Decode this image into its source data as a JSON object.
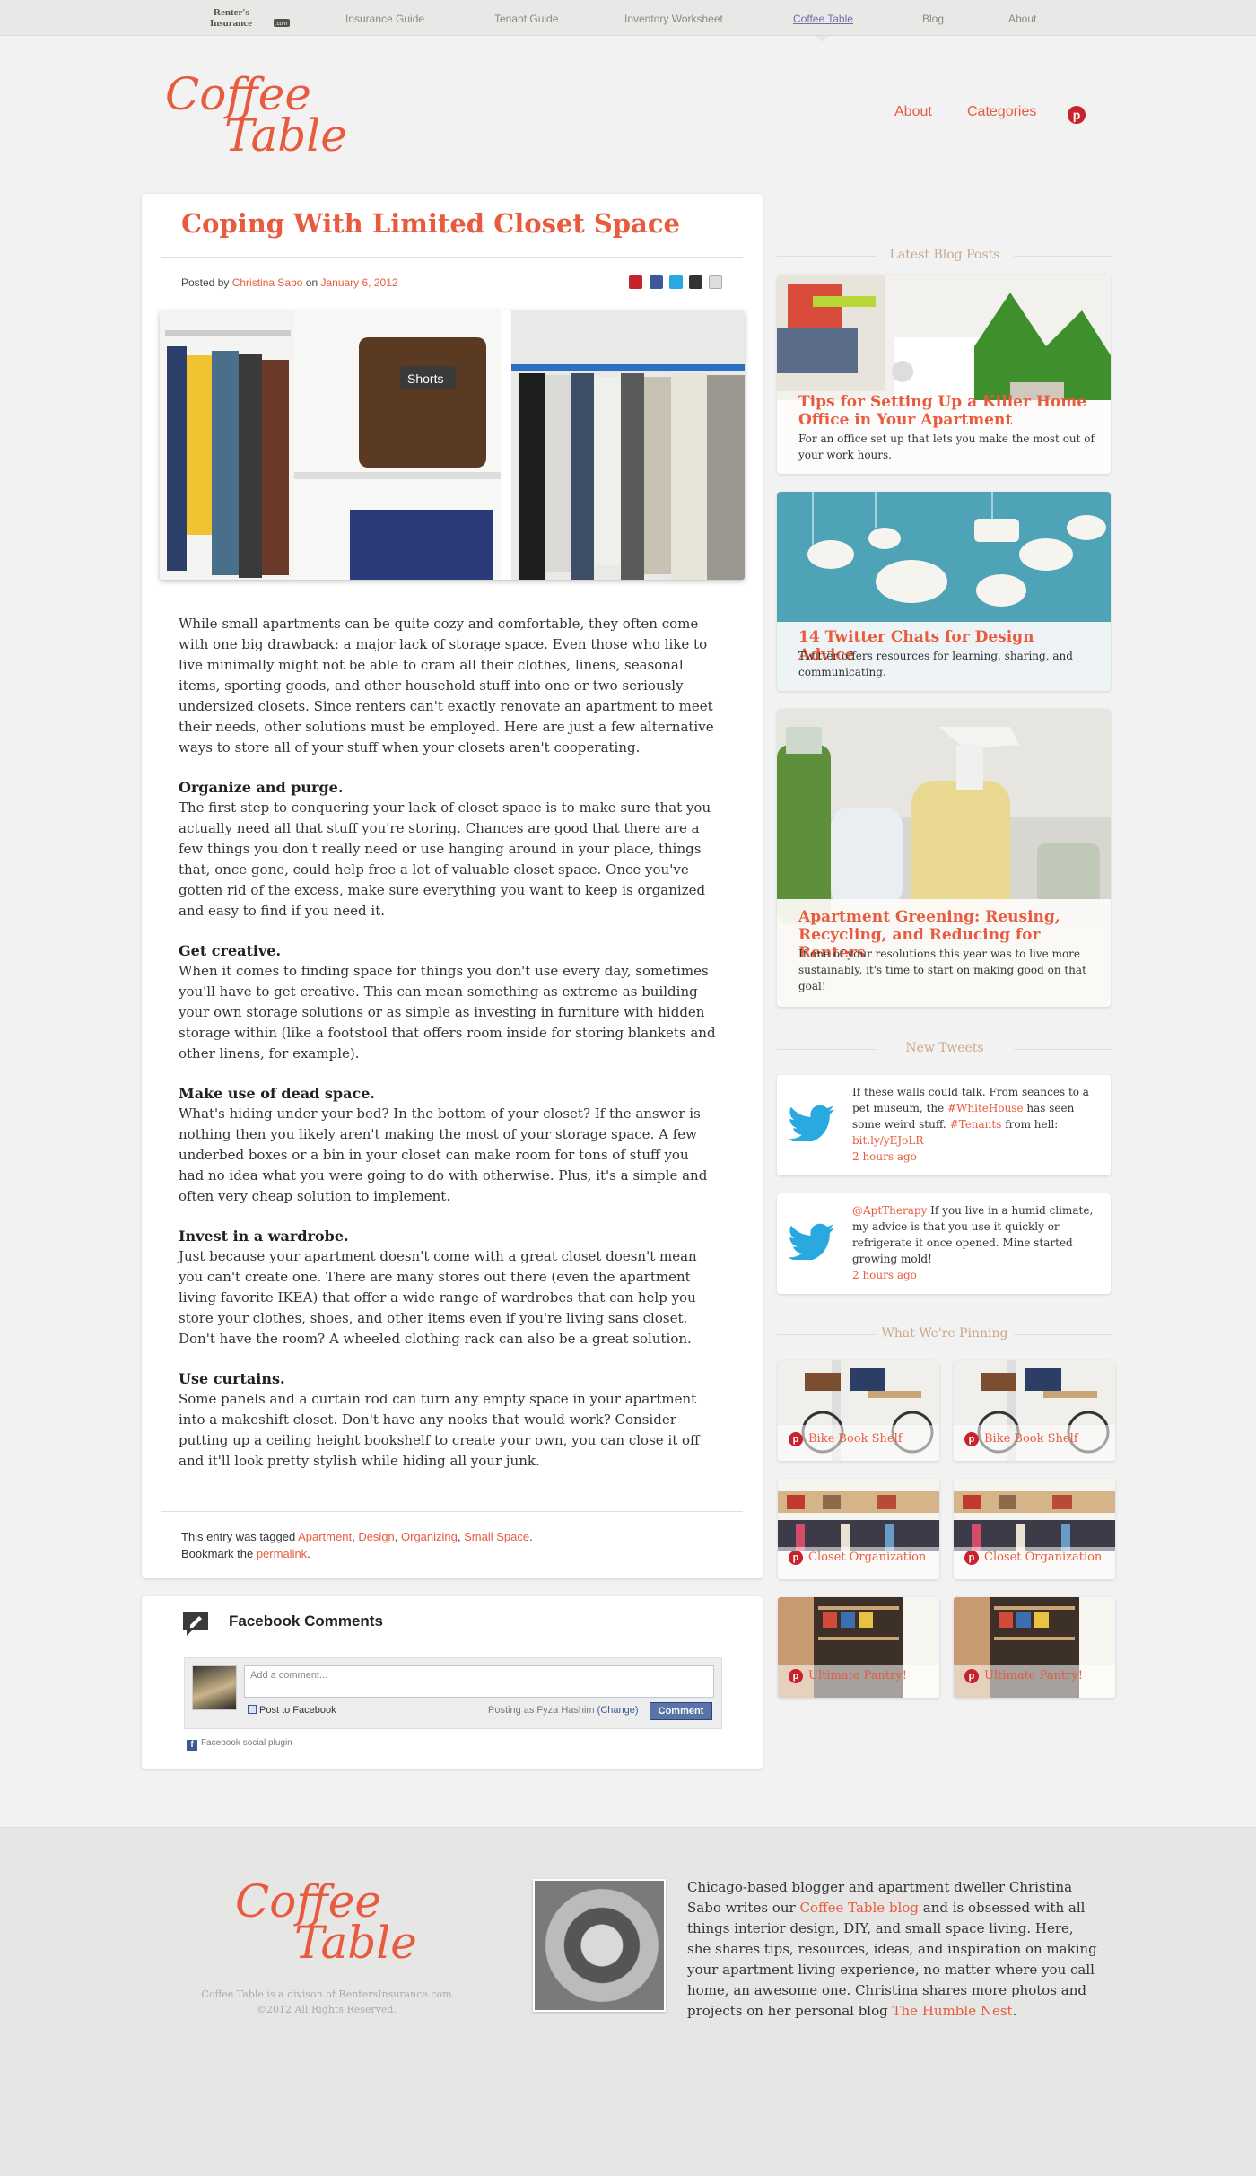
{
  "topbar": {
    "brand_line1": "Renter's",
    "brand_line2": "Insurance",
    "brand_badge": ".com",
    "nav": [
      {
        "label": "Insurance Guide"
      },
      {
        "label": "Tenant Guide"
      },
      {
        "label": "Inventory Worksheet"
      },
      {
        "label": "Coffee Table",
        "active": true
      },
      {
        "label": "Blog"
      },
      {
        "label": "About"
      }
    ]
  },
  "logo": {
    "line1": "Coffee",
    "line2": "Table"
  },
  "header_nav": {
    "about": "About",
    "categories": "Categories",
    "pinterest_icon": "pinterest-icon"
  },
  "article": {
    "title": "Coping With Limited Closet Space",
    "meta": {
      "posted_by": "Posted by",
      "author": "Christina Sabo",
      "on": "on",
      "date": "January 6, 2012"
    },
    "share_icons": [
      "pinterest-icon",
      "facebook-icon",
      "twitter-icon",
      "plus-icon",
      "email-icon"
    ],
    "paragraphs": [
      {
        "heading": "",
        "text": "While small apartments can be quite cozy and comfortable, they often come with one big drawback: a major lack of storage space. Even those who like to live minimally might not be able to cram all their clothes, linens, seasonal items, sporting goods, and other household stuff into one or two seriously undersized closets. Since renters can't exactly renovate an apartment to meet their needs, other solutions must be employed. Here are just a few alternative ways to store all of your stuff when your closets aren't cooperating."
      },
      {
        "heading": "Organize and purge.",
        "text": "The first step to conquering your lack of closet space is to make sure that you actually need all that stuff you're storing. Chances are good that there are a few things you don't really need or use hanging around in your place, things that, once gone, could help free a lot of valuable closet space. Once you've gotten rid of the excess, make sure everything you want to keep is organized and easy to find if you need it."
      },
      {
        "heading": "Get creative.",
        "text": "When it comes to finding space for things you don't use every day, sometimes you'll have to get creative. This can mean something as extreme as building your own storage solutions or as simple as investing in furniture with hidden storage within (like a footstool that offers room inside for storing blankets and other linens, for example)."
      },
      {
        "heading": "Make use of dead space.",
        "text": "What's hiding under your bed? In the bottom of your closet? If the answer is nothing then you likely aren't making the most of your storage space. A few underbed boxes or a bin in your closet can make room for tons of stuff you had no idea what you were going to do with otherwise. Plus, it's a simple and often very cheap solution to implement."
      },
      {
        "heading": "Invest in a wardrobe.",
        "text": "Just because your apartment doesn't come with a great closet doesn't mean you can't create one. There are many stores out there (even the apartment living favorite IKEA) that offer a wide range of wardrobes that can help you store your clothes, shoes, and other items even if you're living sans closet. Don't have the room? A wheeled clothing rack can also be a great solution."
      },
      {
        "heading": "Use curtains.",
        "text": "Some panels and a curtain rod can turn any empty space in your apartment into a makeshift closet. Don't have any nooks that would work? Consider putting up a ceiling height bookshelf to create your own, you can close it off and it'll look pretty stylish while hiding all your junk."
      }
    ],
    "tags_prefix": "This entry was tagged",
    "tags": [
      "Apartment",
      "Design",
      "Organizing",
      "Small Space"
    ],
    "bookmark_prefix": "Bookmark the",
    "permalink": "permalink",
    "hero_label": "Shorts"
  },
  "comments": {
    "title": "Facebook Comments",
    "placeholder": "Add a comment...",
    "post_to_facebook": "Post to Facebook",
    "posting_as": "Posting as Fyza Hashim",
    "change": "(Change)",
    "button": "Comment",
    "plugin": "Facebook social plugin"
  },
  "sidebar": {
    "latest_heading": "Latest Blog Posts",
    "posts": [
      {
        "title": "Tips for Setting Up a Killer Home Office in Your Apartment",
        "desc": "For an office set up that lets you make the most out of your work hours."
      },
      {
        "title": "14 Twitter Chats for Design Advice",
        "desc": "Twitter offers resources for learning, sharing, and communicating."
      },
      {
        "title": "Apartment Greening: Reusing, Recycling, and Reducing for Renters",
        "desc": "If one of your resolutions this year was to live more sustainably, it's time to start on making good on that goal!"
      }
    ],
    "tweets_heading": "New Tweets",
    "tweets": [
      {
        "pre": "If these walls could talk. From seances to a pet museum, the ",
        "tag1": "#WhiteHouse",
        "mid": " has seen some weird stuff. ",
        "tag2": "#Tenants",
        "post": " from hell: ",
        "link": "bit.ly/yEJoLR",
        "time": "2 hours ago"
      },
      {
        "pre": "",
        "tag1": "@AptTherapy",
        "mid": " If you live in a humid climate, my advice is that you use it quickly or refrigerate it once opened. Mine started growing mold!",
        "tag2": "",
        "post": "",
        "link": "",
        "time": "2 hours ago"
      }
    ],
    "pinning_heading": "What We're Pinning",
    "pins": [
      {
        "label": "Bike Book Shelf"
      },
      {
        "label": "Bike Book Shelf"
      },
      {
        "label": "Closet Organization"
      },
      {
        "label": "Closet Organization"
      },
      {
        "label": "Ultimate Pantry!"
      },
      {
        "label": "Ultimate Pantry!"
      }
    ]
  },
  "footer": {
    "copy1": "Coffee Table is a divison of RentersInsurance.com",
    "copy2": "©2012 All Rights Reserved.",
    "bio_pre": "Chicago-based blogger and apartment dweller Christina Sabo writes our ",
    "bio_link1": "Coffee Table blog",
    "bio_mid": " and is obsessed with all things interior design, DIY, and small space living. Here, she shares tips, resources, ideas, and inspiration on making your apartment living experience, no matter where you call home, an awesome one. Christina shares more photos and projects on her personal blog ",
    "bio_link2": "The Humble Nest",
    "bio_end": "."
  },
  "colors": {
    "accent": "#e85b3e",
    "pinterest": "#c8232c",
    "twitter": "#2aa9e0"
  }
}
